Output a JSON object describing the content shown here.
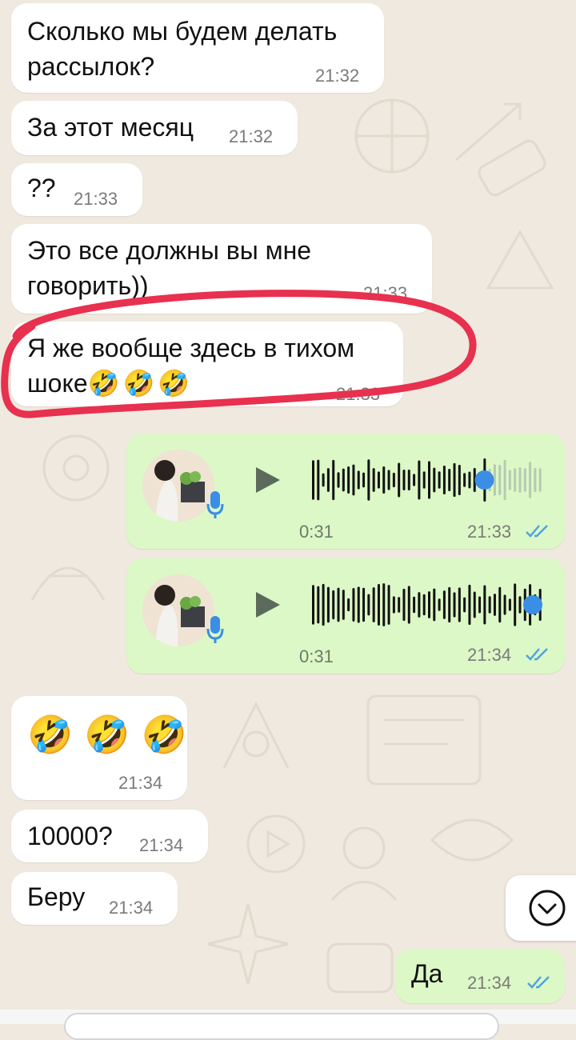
{
  "messages": [
    {
      "id": "m1",
      "text_lines": [
        "Сколько мы будем делать",
        "рассылок?"
      ],
      "time": "21:32"
    },
    {
      "id": "m2",
      "text_lines": [
        "За этот месяц"
      ],
      "time": "21:32"
    },
    {
      "id": "m3",
      "text_lines": [
        "??"
      ],
      "time": "21:33"
    },
    {
      "id": "m4",
      "text_lines": [
        "Это все должны вы мне",
        "говорить))"
      ],
      "time": "21:33"
    },
    {
      "id": "m5",
      "text_lines": [
        "Я же вообще здесь в тихом",
        "шоке"
      ],
      "emoji": "🤣🤣🤣",
      "time": "21:33"
    },
    {
      "id": "m8",
      "emoji": "🤣🤣🤣",
      "time": "21:34"
    },
    {
      "id": "m9",
      "text_lines": [
        "10000?"
      ],
      "time": "21:34"
    },
    {
      "id": "m10",
      "text_lines": [
        "Беру"
      ],
      "time": "21:34"
    }
  ],
  "voice_messages": [
    {
      "id": "v1",
      "duration": "0:31",
      "time": "21:33",
      "progress": 0.75,
      "status": "read"
    },
    {
      "id": "v2",
      "duration": "0:31",
      "time": "21:34",
      "progress": 0.98,
      "status": "read"
    }
  ],
  "outgoing_text": {
    "text": "Да",
    "time": "21:34",
    "status": "read"
  },
  "icons": {
    "play": "play-icon",
    "mic": "microphone-icon",
    "read_ticks": "double-check-icon",
    "scroll_down": "chevron-down-icon"
  },
  "colors": {
    "incoming_bubble": "#ffffff",
    "outgoing_bubble": "#dcf8c6",
    "read_ticks": "#4fa3e0",
    "highlight_ring": "#e8304f",
    "wave_played": "#111111",
    "wave_unplayed": "#b7c9b0",
    "scrubber": "#3a8ee6"
  }
}
